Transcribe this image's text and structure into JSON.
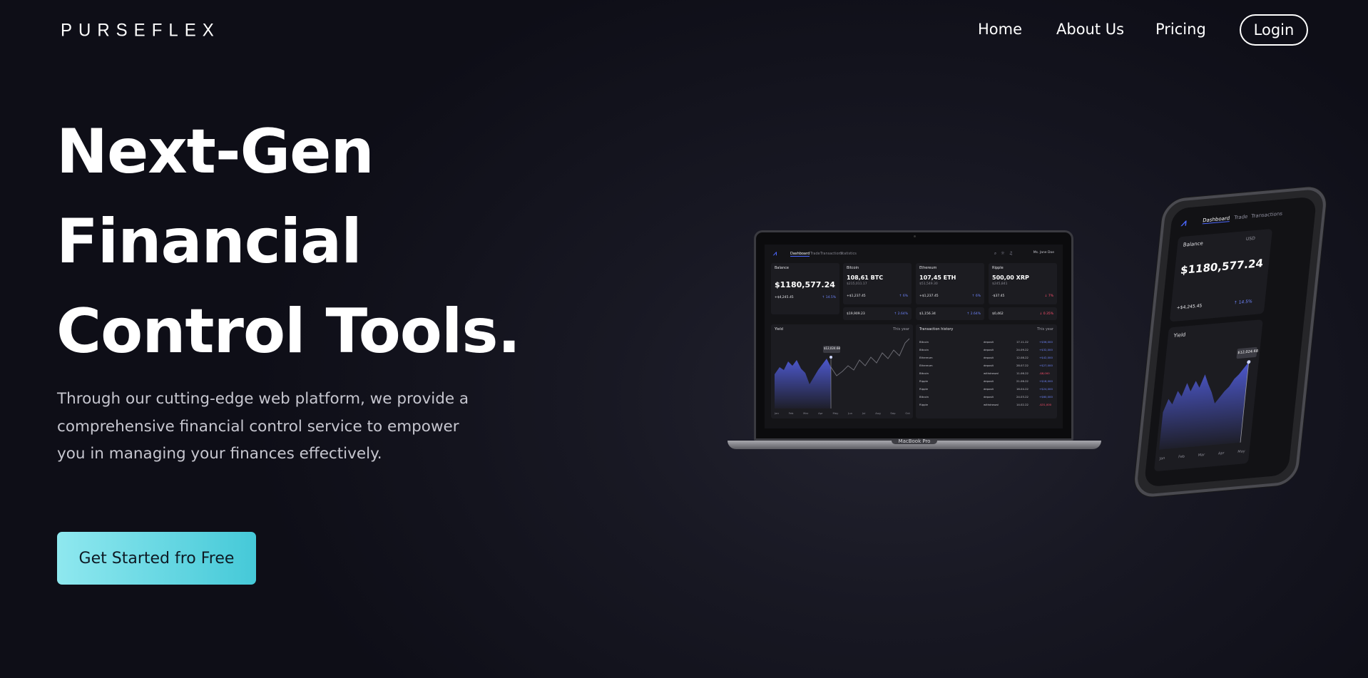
{
  "nav": {
    "logo": "PURSEFLEX",
    "links": [
      "Home",
      "About Us",
      "Pricing"
    ],
    "login": "Login"
  },
  "hero": {
    "title_lines": [
      "Next-Gen",
      "Financial",
      "Control Tools."
    ],
    "description": "Through our cutting-edge web platform, we provide a comprehensive financial control service to empower you in managing your finances effectively.",
    "cta": "Get Started fro Free"
  },
  "laptop": {
    "model_label": "MacBook Pro",
    "tabs": [
      "Dashboard",
      "Trade",
      "Transactions",
      "Statistics"
    ],
    "user": "Ms. Jane Doe",
    "cards": [
      {
        "title": "Balance",
        "value": "$1180,577.24",
        "sub": "",
        "small": "+$4,245.45",
        "pct": "↑ 14.5%"
      },
      {
        "title": "Bitcoin",
        "value": "108,61 BTC",
        "sub": "$215,011.17",
        "small": "+$1,237.45",
        "pct": "↑ 6%"
      },
      {
        "title": "Ethereum",
        "value": "107,45 ETH",
        "sub": "$51,549.30",
        "small": "+$1,237.45",
        "pct": "↑ 6%"
      },
      {
        "title": "Ripple",
        "value": "500,00 XRP",
        "sub": "$245,841",
        "small": "-$37.45",
        "pct": "↓ 7%"
      }
    ],
    "mini_cards": [
      {
        "value": "$19,909.23",
        "pct": "↑ 2.64%"
      },
      {
        "value": "$1,156.34",
        "pct": "↑ 2.64%"
      },
      {
        "value": "$0,462",
        "pct": "↓ 0.35%"
      }
    ],
    "yield_title": "Yield",
    "history_title": "Transaction history",
    "period": "This year",
    "months": [
      "Jan",
      "Feb",
      "Mar",
      "Apr",
      "May",
      "Jun",
      "Jul",
      "Aug",
      "Sep",
      "Oct"
    ],
    "tooltip": "$12,024.68",
    "rows": [
      [
        "Bitcoin",
        "deposit",
        "17.11.22",
        "+$56,000"
      ],
      [
        "Bitcoin",
        "deposit",
        "24.09.22",
        "+$32,000"
      ],
      [
        "Ethereum",
        "deposit",
        "12.08.22",
        "+$42,000"
      ],
      [
        "Ethereum",
        "deposit",
        "28.07.22",
        "+$27,000"
      ],
      [
        "Bitcoin",
        "withdrawal",
        "11.06.22",
        "-$8,000"
      ],
      [
        "Ripple",
        "deposit",
        "21.06.22",
        "+$18,000"
      ],
      [
        "Ripple",
        "deposit",
        "16.04.22",
        "+$24,000"
      ],
      [
        "Bitcoin",
        "deposit",
        "24.03.22",
        "+$60,000"
      ],
      [
        "Ripple",
        "withdrawal",
        "14.02.22",
        "-$31,000"
      ]
    ]
  },
  "phone": {
    "tabs": [
      "Dashboard",
      "Trade",
      "Transactions"
    ],
    "balance_title": "Balance",
    "currency": "USD",
    "balance": "$1180,577.24",
    "profit": "+$4,245.45",
    "pct": "↑ 14.5%",
    "yield_title": "Yield",
    "tooltip": "$12,024.68",
    "months": [
      "Jan",
      "Feb",
      "Mar",
      "Apr",
      "May"
    ]
  }
}
